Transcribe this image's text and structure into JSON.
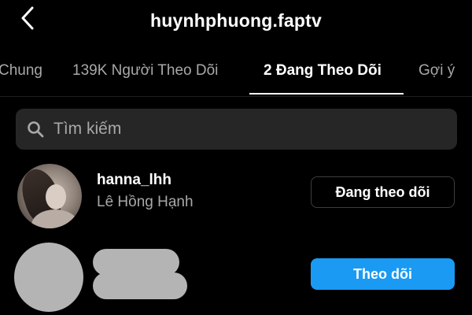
{
  "header": {
    "title": "huynhphuong.faptv",
    "back_icon": "chevron-left-icon"
  },
  "tabs": [
    {
      "label": "Chung",
      "active": false
    },
    {
      "label": "139K Người Theo Dõi",
      "active": false
    },
    {
      "label": "2 Đang Theo Dõi",
      "active": true
    },
    {
      "label": "Gợi ý",
      "active": false
    }
  ],
  "search": {
    "placeholder": "Tìm kiếm",
    "icon": "search-icon"
  },
  "users": [
    {
      "username": "hanna_lhh",
      "fullname": "Lê Hồng Hạnh",
      "button_label": "Đang theo dõi"
    },
    {
      "username": "",
      "fullname": "",
      "button_label": "Theo dõi",
      "obscured": true
    }
  ],
  "colors": {
    "background": "#000000",
    "search_bg": "#262626",
    "secondary_text": "#a8a8a8",
    "primary_button": "#1a9af3"
  }
}
